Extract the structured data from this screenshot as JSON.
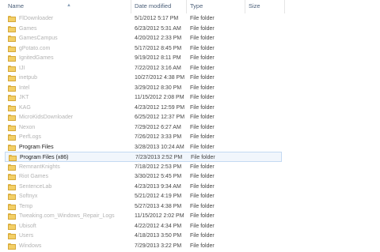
{
  "header": {
    "name": "Name",
    "date": "Date modified",
    "type": "Type",
    "size": "Size"
  },
  "icons": {
    "folder": "folder-icon",
    "sort": "sort-up-icon"
  },
  "rows": [
    {
      "name": "FlDownloader",
      "date": "5/1/2012 5:17 PM",
      "type": "File folder",
      "state": "dim"
    },
    {
      "name": "Games",
      "date": "6/23/2012 5:31 AM",
      "type": "File folder",
      "state": "dim"
    },
    {
      "name": "GamesCampus",
      "date": "4/20/2012 2:33 PM",
      "type": "File folder",
      "state": "dim"
    },
    {
      "name": "gPotato.com",
      "date": "5/17/2012 8:45 PM",
      "type": "File folder",
      "state": "dim"
    },
    {
      "name": "IgnitedGames",
      "date": "9/19/2012 8:11 PM",
      "type": "File folder",
      "state": "dim"
    },
    {
      "name": "IJI",
      "date": "7/22/2012 3:16 AM",
      "type": "File folder",
      "state": "dim"
    },
    {
      "name": "inetpub",
      "date": "10/27/2012 4:38 PM",
      "type": "File folder",
      "state": "dim"
    },
    {
      "name": "Intel",
      "date": "3/29/2012 8:30 PM",
      "type": "File folder",
      "state": "dim"
    },
    {
      "name": "JKT",
      "date": "11/15/2012 2:08 PM",
      "type": "File folder",
      "state": "dim"
    },
    {
      "name": "KAG",
      "date": "4/23/2012 12:59 PM",
      "type": "File folder",
      "state": "dim"
    },
    {
      "name": "MicroKidsDownloader",
      "date": "6/25/2012 12:37 PM",
      "type": "File folder",
      "state": "dim"
    },
    {
      "name": "Nexon",
      "date": "7/29/2012 6:27 AM",
      "type": "File folder",
      "state": "dim"
    },
    {
      "name": "PerfLogs",
      "date": "7/26/2012 3:33 PM",
      "type": "File folder",
      "state": "dim"
    },
    {
      "name": "Program Files",
      "date": "3/28/2013 10:24 AM",
      "type": "File folder",
      "state": "dark"
    },
    {
      "name": "Program Files (x86)",
      "date": "7/23/2013 2:52 PM",
      "type": "File folder",
      "state": "selected"
    },
    {
      "name": "RemnantKnights",
      "date": "7/18/2012 2:53 PM",
      "type": "File folder",
      "state": "dim"
    },
    {
      "name": "Riot Games",
      "date": "3/30/2012 5:45 PM",
      "type": "File folder",
      "state": "dim"
    },
    {
      "name": "SentenceLab",
      "date": "4/23/2013 9:34 AM",
      "type": "File folder",
      "state": "dim"
    },
    {
      "name": "Softnyx",
      "date": "5/21/2012 4:19 PM",
      "type": "File folder",
      "state": "dim"
    },
    {
      "name": "Temp",
      "date": "5/27/2013 4:38 PM",
      "type": "File folder",
      "state": "dim"
    },
    {
      "name": "Tweaking.com_Windows_Repair_Logs",
      "date": "11/15/2012 2:02 PM",
      "type": "File folder",
      "state": "dim"
    },
    {
      "name": "Ubisoft",
      "date": "4/22/2012 4:34 PM",
      "type": "File folder",
      "state": "dim"
    },
    {
      "name": "Users",
      "date": "4/18/2013 3:50 PM",
      "type": "File folder",
      "state": "dim"
    },
    {
      "name": "Windows",
      "date": "7/29/2013 3:22 PM",
      "type": "File folder",
      "state": "dim"
    }
  ]
}
